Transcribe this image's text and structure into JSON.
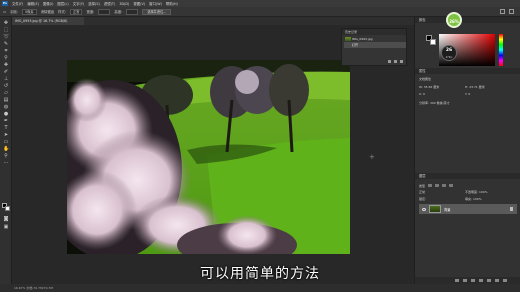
{
  "menubar": {
    "logo": "Ps",
    "items": [
      "文件(F)",
      "编辑(E)",
      "图像(I)",
      "图层(L)",
      "文字(Y)",
      "选择(S)",
      "滤镜(T)",
      "3D(D)",
      "视图(V)",
      "窗口(W)",
      "帮助(H)"
    ]
  },
  "options": {
    "feather_label": "羽化:",
    "feather_value": "0像素",
    "antialias_label": "消除锯齿",
    "style_label": "样式:",
    "style_value": "正常",
    "width_label": "宽度:",
    "height_label": "高度:",
    "select_mask_button": "选择并遮住..."
  },
  "document": {
    "tab_title": "IMG_0993.jpg @ 16.7% (RGB/8)"
  },
  "history_panel": {
    "title": "历史记录",
    "source_item": "IMG_0993.jpg",
    "step_item": "打开"
  },
  "right_panel": {
    "color_tab": "颜色",
    "properties_tab": "属性",
    "properties_title": "文档属性",
    "prop_w": "W: 35.56 厘米",
    "prop_h": "H: 23.71 厘米",
    "prop_x": "X: 0",
    "prop_y": "Y: 0",
    "prop_res": "分辨率: 300 像素/英寸",
    "layers_tab": "图层",
    "layer_kind": "类型",
    "layer_mode": "正常",
    "layer_opacity": "不透明度: 100%",
    "layer_lock": "锁定:",
    "layer_fill": "填充: 100%",
    "layer_name": "背景"
  },
  "badges": {
    "green": "26%",
    "dark_value": "26",
    "dark_sub": "47K/s"
  },
  "status": {
    "zoom_text": "16.67%    文档:70.7M/70.7M"
  },
  "subtitle": "可以用简单的方法"
}
